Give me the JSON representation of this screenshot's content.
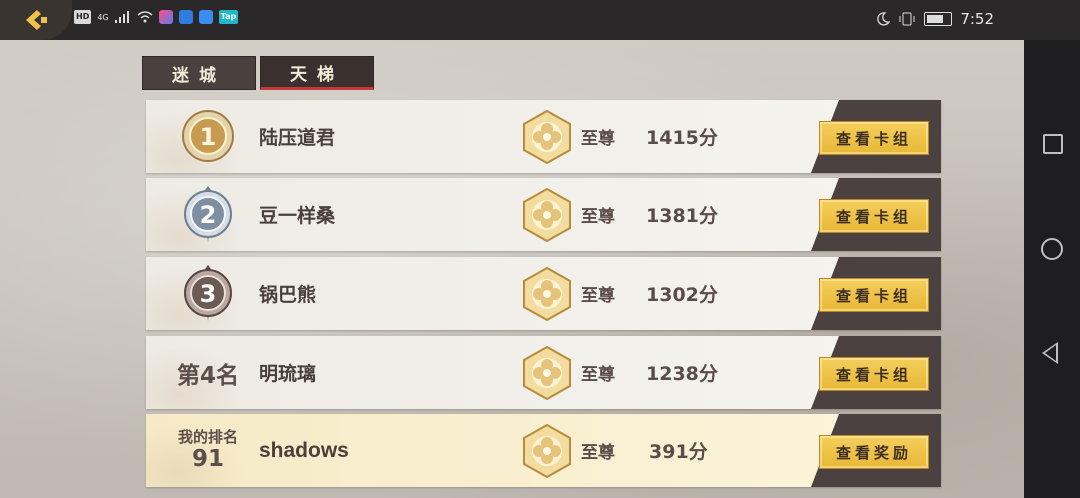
{
  "status_bar": {
    "left_icons": [
      "HD",
      "4G",
      "signal-icon",
      "wifi-icon",
      "app-icon",
      "app-icon",
      "app-icon",
      "Tap"
    ],
    "hd": "HD",
    "net": "4G",
    "tap": "Tap",
    "time": "7:52"
  },
  "tabs": [
    {
      "label": "迷城",
      "active": false
    },
    {
      "label": "天梯",
      "active": true
    }
  ],
  "ranking": [
    {
      "rank": "1",
      "rank_text": "",
      "name": "陆压道君",
      "tier": "至尊",
      "score": "1415分",
      "button": "查看卡组"
    },
    {
      "rank": "2",
      "rank_text": "",
      "name": "豆一样桑",
      "tier": "至尊",
      "score": "1381分",
      "button": "查看卡组"
    },
    {
      "rank": "3",
      "rank_text": "",
      "name": "锅巴熊",
      "tier": "至尊",
      "score": "1302分",
      "button": "查看卡组"
    },
    {
      "rank": "4",
      "rank_text": "第4名",
      "name": "明琉璃",
      "tier": "至尊",
      "score": "1238分",
      "button": "查看卡组"
    }
  ],
  "my_rank": {
    "label": "我的排名",
    "rank": "91",
    "name": "shadows",
    "tier": "至尊",
    "score": "391分",
    "button": "查看奖励"
  },
  "colors": {
    "gold_medal": "#c9a15c",
    "silver_medal": "#7f8ea0",
    "bronze_medal": "#6d5a55",
    "button_gold": "#f0c547",
    "row_dark": "#4a4140",
    "tab_active_underline": "#c9383a"
  }
}
